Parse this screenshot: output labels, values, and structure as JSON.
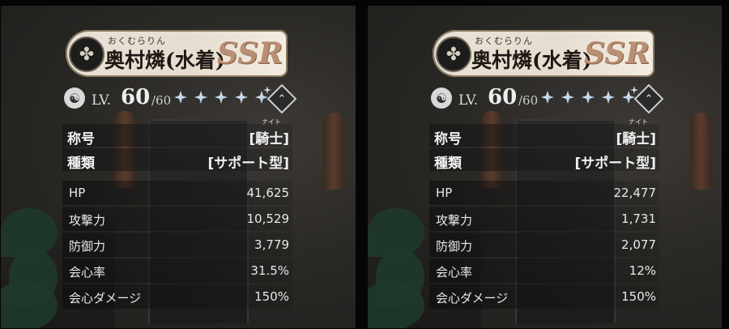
{
  "cards": [
    {
      "furigana": "おくむらりん",
      "name": "奥村燐(水着)",
      "rarity": "SSR",
      "level_prefix": "LV.",
      "level": "60",
      "level_max": "/60",
      "stars": 5,
      "title_label": "称号",
      "title_ruby": "ナイト",
      "title_value": "[騎士]",
      "type_label": "種類",
      "type_value": "[サポート型]",
      "stats": [
        {
          "label": "HP",
          "value": "41,625"
        },
        {
          "label": "攻撃力",
          "value": "10,529"
        },
        {
          "label": "防御力",
          "value": "3,779"
        },
        {
          "label": "会心率",
          "value": "31.5%"
        },
        {
          "label": "会心ダメージ",
          "value": "150%"
        }
      ]
    },
    {
      "furigana": "おくむらりん",
      "name": "奥村燐(水着)",
      "rarity": "SSR",
      "level_prefix": "LV.",
      "level": "60",
      "level_max": "/60",
      "stars": 5,
      "title_label": "称号",
      "title_ruby": "ナイト",
      "title_value": "[騎士]",
      "type_label": "種類",
      "type_value": "[サポート型]",
      "stats": [
        {
          "label": "HP",
          "value": "22,477"
        },
        {
          "label": "攻撃力",
          "value": "1,731"
        },
        {
          "label": "防御力",
          "value": "2,077"
        },
        {
          "label": "会心率",
          "value": "12%"
        },
        {
          "label": "会心ダメージ",
          "value": "150%"
        }
      ]
    }
  ],
  "icons": {
    "crest": "clan-crest-icon",
    "element": "triskelion-element-icon",
    "star": "star-icon",
    "limit_break": "chevron-up-icon"
  }
}
